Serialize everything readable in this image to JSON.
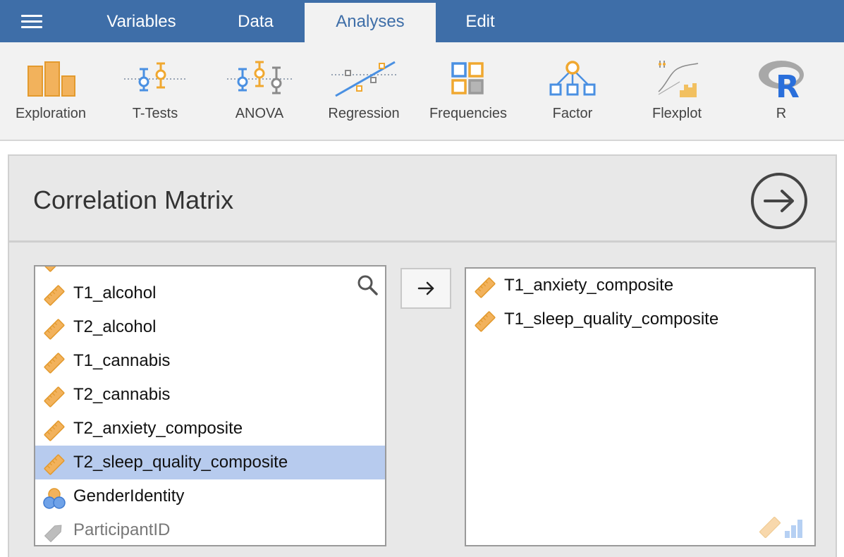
{
  "menu": {
    "tabs": [
      {
        "label": "Variables"
      },
      {
        "label": "Data"
      },
      {
        "label": "Analyses"
      },
      {
        "label": "Edit"
      }
    ],
    "active_tab": "Analyses"
  },
  "ribbon": {
    "items": [
      {
        "label": "Exploration",
        "icon": "exploration-icon"
      },
      {
        "label": "T-Tests",
        "icon": "t-tests-icon"
      },
      {
        "label": "ANOVA",
        "icon": "anova-icon"
      },
      {
        "label": "Regression",
        "icon": "regression-icon"
      },
      {
        "label": "Frequencies",
        "icon": "frequencies-icon"
      },
      {
        "label": "Factor",
        "icon": "factor-icon"
      },
      {
        "label": "Flexplot",
        "icon": "flexplot-icon"
      },
      {
        "label": "R",
        "icon": "r-icon"
      }
    ]
  },
  "panel": {
    "title": "Correlation Matrix",
    "available_variables": [
      {
        "name": "T1_alcohol",
        "type": "continuous"
      },
      {
        "name": "T2_alcohol",
        "type": "continuous"
      },
      {
        "name": "T1_cannabis",
        "type": "continuous"
      },
      {
        "name": "T2_cannabis",
        "type": "continuous"
      },
      {
        "name": "T2_anxiety_composite",
        "type": "continuous"
      },
      {
        "name": "T2_sleep_quality_composite",
        "type": "continuous",
        "selected": true
      },
      {
        "name": "GenderIdentity",
        "type": "nominal"
      },
      {
        "name": "ParticipantID",
        "type": "id"
      }
    ],
    "selected_variables": [
      {
        "name": "T1_anxiety_composite",
        "type": "continuous"
      },
      {
        "name": "T1_sleep_quality_composite",
        "type": "continuous"
      }
    ]
  },
  "colors": {
    "menu_bar": "#3e6ea8",
    "ribbon_bg": "#f2f2f2",
    "selection": "#b7cbee",
    "ruler_icon": "#f0a830",
    "accent_blue": "#4a90e2"
  }
}
